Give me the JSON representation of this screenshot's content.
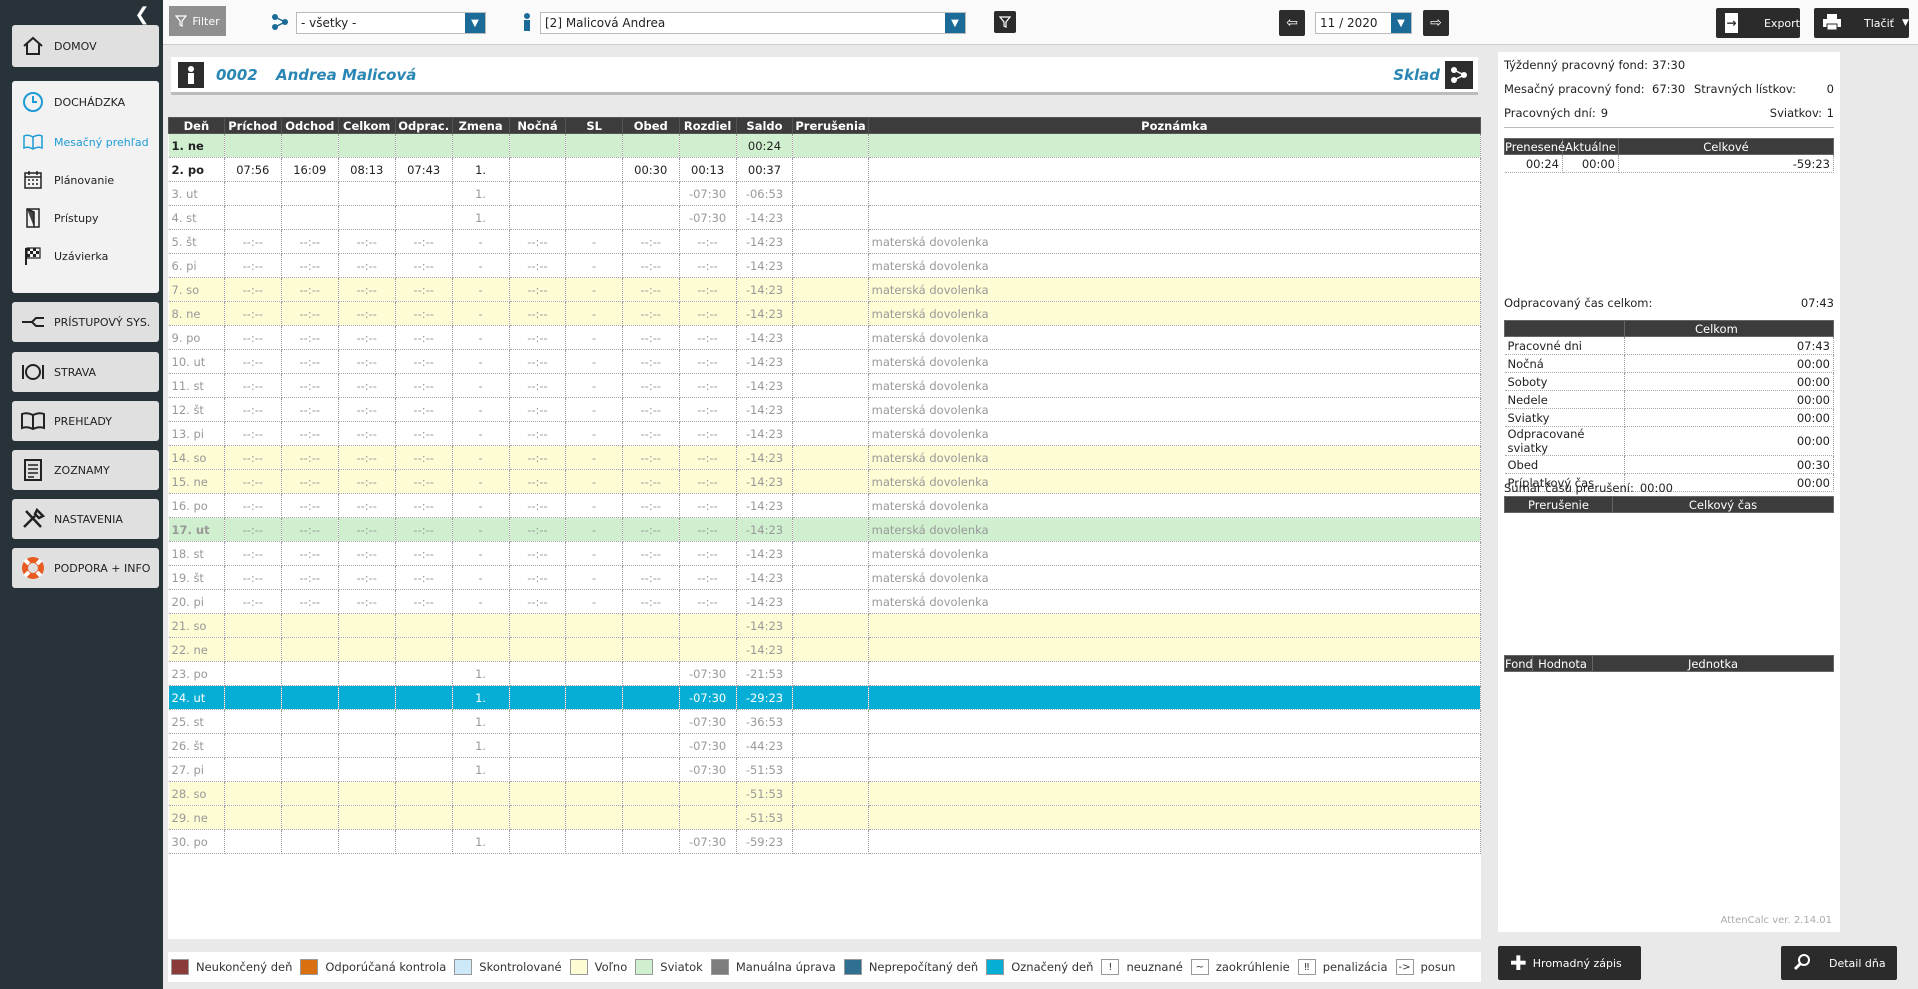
{
  "sidebar": {
    "items": [
      {
        "label": "DOMOV",
        "icon": "home-icon"
      },
      {
        "label": "DOCHÁDZKA",
        "icon": "clock-icon"
      },
      {
        "label": "PRÍSTUPOVÝ SYS.",
        "icon": "access-icon"
      },
      {
        "label": "STRAVA",
        "icon": "meal-icon"
      },
      {
        "label": "PREHĽADY",
        "icon": "reports-icon"
      },
      {
        "label": "ZOZNAMY",
        "icon": "list-icon"
      },
      {
        "label": "NASTAVENIA",
        "icon": "settings-icon"
      },
      {
        "label": "PODPORA + INFO",
        "icon": "support-icon"
      }
    ],
    "subitems": [
      {
        "label": "Mesačný prehľad",
        "icon": "book-icon"
      },
      {
        "label": "Plánovanie",
        "icon": "calendar-icon"
      },
      {
        "label": "Prístupy",
        "icon": "door-icon"
      },
      {
        "label": "Uzávierka",
        "icon": "flag-icon"
      }
    ]
  },
  "topbar": {
    "filter_label": "Filter",
    "group_value": "- všetky -",
    "employee_value": "[2] Malicová Andrea",
    "period_value": "11 / 2020",
    "export_label": "Export",
    "print_label": "Tlačiť"
  },
  "employee": {
    "code": "0002",
    "name": "Andrea Malicová",
    "dept": "Sklad"
  },
  "table": {
    "headers": [
      "Deň",
      "Príchod",
      "Odchod",
      "Celkom",
      "Odprac.",
      "Zmena",
      "Nočná",
      "SL",
      "Obed",
      "Rozdiel",
      "Saldo",
      "Prerušenia",
      "Poznámka"
    ],
    "rows": [
      {
        "cls": "green bold",
        "c": [
          "1. ne",
          "",
          "",
          "",
          "",
          "",
          "",
          "",
          "",
          "",
          "00:24",
          "",
          ""
        ]
      },
      {
        "cls": "bold",
        "c": [
          "2. po",
          "07:56",
          "16:09",
          "08:13",
          "07:43",
          "1.",
          "",
          "",
          "00:30",
          "00:13",
          "00:37",
          "",
          ""
        ]
      },
      {
        "cls": "future",
        "c": [
          "3. ut",
          "",
          "",
          "",
          "",
          "1.",
          "",
          "",
          "",
          "-07:30",
          "-06:53",
          "",
          ""
        ]
      },
      {
        "cls": "future",
        "c": [
          "4. st",
          "",
          "",
          "",
          "",
          "1.",
          "",
          "",
          "",
          "-07:30",
          "-14:23",
          "",
          ""
        ]
      },
      {
        "cls": "future",
        "c": [
          "5. št",
          "--:--",
          "--:--",
          "--:--",
          "--:--",
          "-",
          "--:--",
          "-",
          "--:--",
          "--:--",
          "-14:23",
          "",
          "materská dovolenka"
        ]
      },
      {
        "cls": "future",
        "c": [
          "6. pi",
          "--:--",
          "--:--",
          "--:--",
          "--:--",
          "-",
          "--:--",
          "-",
          "--:--",
          "--:--",
          "-14:23",
          "",
          "materská dovolenka"
        ]
      },
      {
        "cls": "future yellow",
        "c": [
          "7. so",
          "--:--",
          "--:--",
          "--:--",
          "--:--",
          "-",
          "--:--",
          "-",
          "--:--",
          "--:--",
          "-14:23",
          "",
          "materská dovolenka"
        ]
      },
      {
        "cls": "future yellow",
        "c": [
          "8. ne",
          "--:--",
          "--:--",
          "--:--",
          "--:--",
          "-",
          "--:--",
          "-",
          "--:--",
          "--:--",
          "-14:23",
          "",
          "materská dovolenka"
        ]
      },
      {
        "cls": "future",
        "c": [
          "9. po",
          "--:--",
          "--:--",
          "--:--",
          "--:--",
          "-",
          "--:--",
          "-",
          "--:--",
          "--:--",
          "-14:23",
          "",
          "materská dovolenka"
        ]
      },
      {
        "cls": "future",
        "c": [
          "10. ut",
          "--:--",
          "--:--",
          "--:--",
          "--:--",
          "-",
          "--:--",
          "-",
          "--:--",
          "--:--",
          "-14:23",
          "",
          "materská dovolenka"
        ]
      },
      {
        "cls": "future",
        "c": [
          "11. st",
          "--:--",
          "--:--",
          "--:--",
          "--:--",
          "-",
          "--:--",
          "-",
          "--:--",
          "--:--",
          "-14:23",
          "",
          "materská dovolenka"
        ]
      },
      {
        "cls": "future",
        "c": [
          "12. št",
          "--:--",
          "--:--",
          "--:--",
          "--:--",
          "-",
          "--:--",
          "-",
          "--:--",
          "--:--",
          "-14:23",
          "",
          "materská dovolenka"
        ]
      },
      {
        "cls": "future",
        "c": [
          "13. pi",
          "--:--",
          "--:--",
          "--:--",
          "--:--",
          "-",
          "--:--",
          "-",
          "--:--",
          "--:--",
          "-14:23",
          "",
          "materská dovolenka"
        ]
      },
      {
        "cls": "future yellow",
        "c": [
          "14. so",
          "--:--",
          "--:--",
          "--:--",
          "--:--",
          "-",
          "--:--",
          "-",
          "--:--",
          "--:--",
          "-14:23",
          "",
          "materská dovolenka"
        ]
      },
      {
        "cls": "future yellow",
        "c": [
          "15. ne",
          "--:--",
          "--:--",
          "--:--",
          "--:--",
          "-",
          "--:--",
          "-",
          "--:--",
          "--:--",
          "-14:23",
          "",
          "materská dovolenka"
        ]
      },
      {
        "cls": "future",
        "c": [
          "16. po",
          "--:--",
          "--:--",
          "--:--",
          "--:--",
          "-",
          "--:--",
          "-",
          "--:--",
          "--:--",
          "-14:23",
          "",
          "materská dovolenka"
        ]
      },
      {
        "cls": "future green bold",
        "c": [
          "17. ut",
          "--:--",
          "--:--",
          "--:--",
          "--:--",
          "-",
          "--:--",
          "-",
          "--:--",
          "--:--",
          "-14:23",
          "",
          "materská dovolenka"
        ]
      },
      {
        "cls": "future",
        "c": [
          "18. st",
          "--:--",
          "--:--",
          "--:--",
          "--:--",
          "-",
          "--:--",
          "-",
          "--:--",
          "--:--",
          "-14:23",
          "",
          "materská dovolenka"
        ]
      },
      {
        "cls": "future",
        "c": [
          "19. št",
          "--:--",
          "--:--",
          "--:--",
          "--:--",
          "-",
          "--:--",
          "-",
          "--:--",
          "--:--",
          "-14:23",
          "",
          "materská dovolenka"
        ]
      },
      {
        "cls": "future",
        "c": [
          "20. pi",
          "--:--",
          "--:--",
          "--:--",
          "--:--",
          "-",
          "--:--",
          "-",
          "--:--",
          "--:--",
          "-14:23",
          "",
          "materská dovolenka"
        ]
      },
      {
        "cls": "future yellow",
        "c": [
          "21. so",
          "",
          "",
          "",
          "",
          "",
          "",
          "",
          "",
          "",
          "-14:23",
          "",
          ""
        ]
      },
      {
        "cls": "future yellow",
        "c": [
          "22. ne",
          "",
          "",
          "",
          "",
          "",
          "",
          "",
          "",
          "",
          "-14:23",
          "",
          ""
        ]
      },
      {
        "cls": "future",
        "c": [
          "23. po",
          "",
          "",
          "",
          "",
          "1.",
          "",
          "",
          "",
          "-07:30",
          "-21:53",
          "",
          ""
        ]
      },
      {
        "cls": "sel",
        "c": [
          "24. ut",
          "",
          "",
          "",
          "",
          "1.",
          "",
          "",
          "",
          "-07:30",
          "-29:23",
          "",
          ""
        ]
      },
      {
        "cls": "future",
        "c": [
          "25. st",
          "",
          "",
          "",
          "",
          "1.",
          "",
          "",
          "",
          "-07:30",
          "-36:53",
          "",
          ""
        ]
      },
      {
        "cls": "future",
        "c": [
          "26. št",
          "",
          "",
          "",
          "",
          "1.",
          "",
          "",
          "",
          "-07:30",
          "-44:23",
          "",
          ""
        ]
      },
      {
        "cls": "future",
        "c": [
          "27. pi",
          "",
          "",
          "",
          "",
          "1.",
          "",
          "",
          "",
          "-07:30",
          "-51:53",
          "",
          ""
        ]
      },
      {
        "cls": "future yellow",
        "c": [
          "28. so",
          "",
          "",
          "",
          "",
          "",
          "",
          "",
          "",
          "",
          "-51:53",
          "",
          ""
        ]
      },
      {
        "cls": "future yellow",
        "c": [
          "29. ne",
          "",
          "",
          "",
          "",
          "",
          "",
          "",
          "",
          "",
          "-51:53",
          "",
          ""
        ]
      },
      {
        "cls": "future",
        "c": [
          "30. po",
          "",
          "",
          "",
          "",
          "1.",
          "",
          "",
          "",
          "-07:30",
          "-59:23",
          "",
          ""
        ]
      }
    ]
  },
  "legend": [
    {
      "color": "#8b3a3a",
      "label": "Neukončený deň"
    },
    {
      "color": "#d9700f",
      "label": "Odporúčaná kontrola"
    },
    {
      "color": "#cde8f8",
      "label": "Skontrolované"
    },
    {
      "color": "#fdfcd4",
      "label": "Voľno"
    },
    {
      "color": "#cfefcf",
      "label": "Sviatok"
    },
    {
      "color": "#7d7d7d",
      "label": "Manuálna úprava"
    },
    {
      "color": "#2f6f8f",
      "label": "Neprepočítaný deň"
    },
    {
      "color": "#06aed5",
      "label": "Označený deň"
    }
  ],
  "legend_symbols": [
    {
      "sym": "!",
      "label": "neuznané"
    },
    {
      "sym": "~",
      "label": "zaokrúhlenie"
    },
    {
      "sym": "‼",
      "label": "penalizácia"
    },
    {
      "sym": "->",
      "label": "posun"
    }
  ],
  "right": {
    "weekly_label": "Týždenný pracovný fond:",
    "weekly_value": "37:30",
    "monthly_label": "Mesačný pracovný fond:",
    "monthly_value": "67:30",
    "meal_label": "Stravných lístkov:",
    "meal_value": "0",
    "workdays_label": "Pracovných dní:",
    "workdays_value": "9",
    "holidays_label": "Sviatkov:",
    "holidays_value": "1",
    "balance_headers": [
      "Prenesené",
      "Aktuálne",
      "Celkové"
    ],
    "balance_values": [
      "00:24",
      "00:00",
      "-59:23"
    ],
    "worked_label": "Odpracovaný čas celkom:",
    "worked_value": "07:43",
    "summary_header": "Celkom",
    "summary": [
      {
        "label": "Pracovné dni",
        "value": "07:43"
      },
      {
        "label": "Nočná",
        "value": "00:00"
      },
      {
        "label": "Soboty",
        "value": "00:00"
      },
      {
        "label": "Nedele",
        "value": "00:00"
      },
      {
        "label": "Sviatky",
        "value": "00:00"
      },
      {
        "label": "Odpracované sviatky",
        "value": "00:00"
      },
      {
        "label": "Obed",
        "value": "00:30"
      },
      {
        "label": "Príplatkový čas",
        "value": "00:00"
      }
    ],
    "breaks_label": "Sumár času prerušení:",
    "breaks_value": "00:00",
    "breaks_headers": [
      "Prerušenie",
      "Celkový čas"
    ],
    "fund_headers": [
      "Fond",
      "Hodnota",
      "Jednotka"
    ],
    "version": "AttenCalc ver. 2.14.01"
  },
  "bottom": {
    "bulk_label": "Hromadný zápis",
    "detail_label": "Detail dňa"
  }
}
